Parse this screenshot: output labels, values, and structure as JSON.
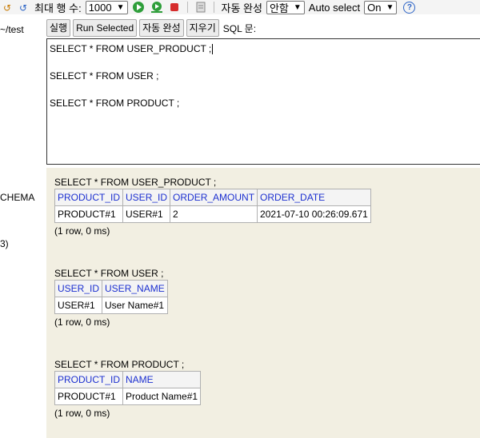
{
  "toolbar": {
    "max_rows_label": "최대 행 수:",
    "max_rows_value": "1000",
    "autocomplete_label": "자동 완성",
    "autocomplete_value": "안함",
    "auto_select_label": "Auto select",
    "auto_select_value": "On",
    "help_glyph": "?"
  },
  "left_panel": {
    "path": "~/test",
    "schema_fragment": "CHEMA",
    "count_fragment": "3)"
  },
  "buttons": {
    "run": "실행",
    "run_selected": "Run Selected",
    "autocomplete": "자동 완성",
    "clear": "지우기",
    "sql_label": "SQL 문:"
  },
  "editor": {
    "lines": [
      "SELECT * FROM USER_PRODUCT ;",
      "SELECT * FROM USER ;",
      "SELECT * FROM PRODUCT ;"
    ]
  },
  "results": [
    {
      "query": "SELECT * FROM USER_PRODUCT ;",
      "columns": [
        "PRODUCT_ID",
        "USER_ID",
        "ORDER_AMOUNT",
        "ORDER_DATE"
      ],
      "rows": [
        [
          "PRODUCT#1",
          "USER#1",
          "2",
          "2021-07-10 00:26:09.671"
        ]
      ],
      "info": "(1 row, 0 ms)"
    },
    {
      "query": "SELECT * FROM USER ;",
      "columns": [
        "USER_ID",
        "USER_NAME"
      ],
      "rows": [
        [
          "USER#1",
          "User Name#1"
        ]
      ],
      "info": "(1 row, 0 ms)"
    },
    {
      "query": "SELECT * FROM PRODUCT ;",
      "columns": [
        "PRODUCT_ID",
        "NAME"
      ],
      "rows": [
        [
          "PRODUCT#1",
          "Product Name#1"
        ]
      ],
      "info": "(1 row, 0 ms)"
    }
  ],
  "colors": {
    "results_bg": "#f2efe2",
    "header_text": "#1b2fd0",
    "run_green": "#2e9e3a",
    "stop_red": "#d62b2b"
  }
}
